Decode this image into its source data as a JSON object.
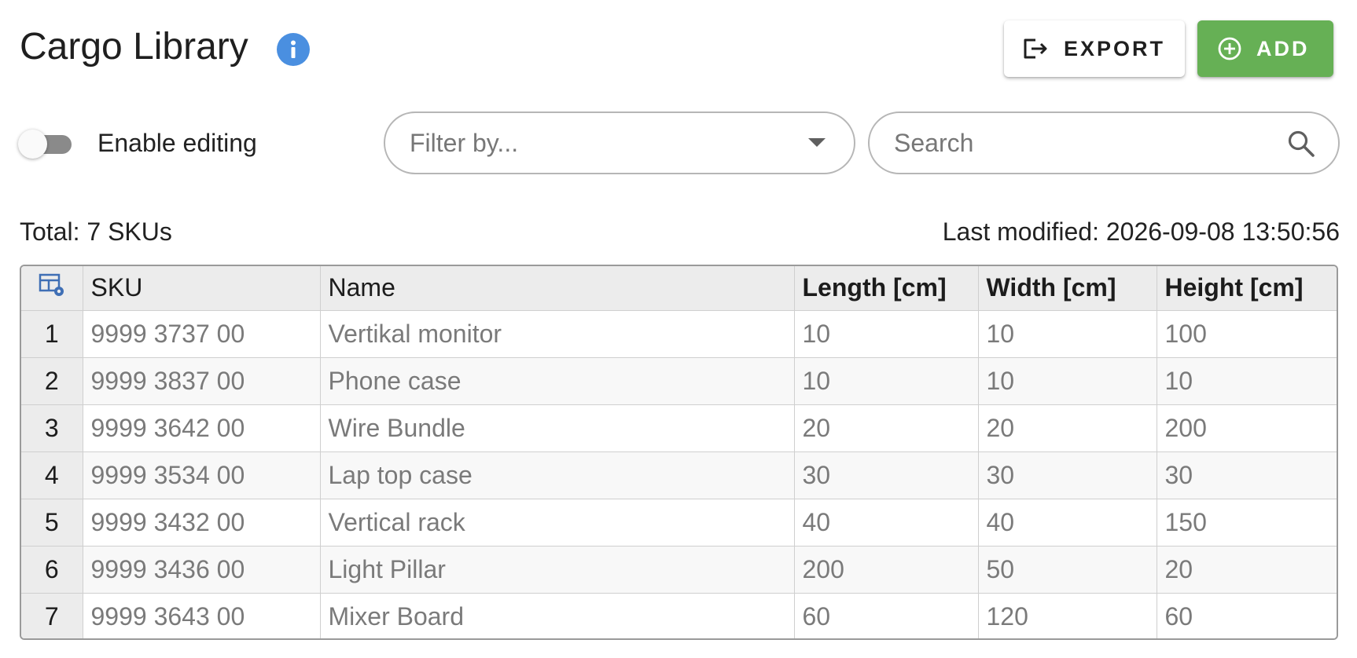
{
  "header": {
    "title": "Cargo Library",
    "export_label": "EXPORT",
    "add_label": "ADD"
  },
  "toolbar": {
    "toggle_label": "Enable editing",
    "toggle_on": false,
    "filter_placeholder": "Filter by...",
    "search_placeholder": "Search"
  },
  "summary": {
    "total": "Total: 7 SKUs",
    "last_modified": "Last modified: 2026-09-08 13:50:56"
  },
  "table": {
    "columns": [
      "SKU",
      "Name",
      "Length [cm]",
      "Width [cm]",
      "Height [cm]"
    ],
    "rows": [
      {
        "num": "1",
        "sku": "9999 3737 00",
        "name": "Vertikal monitor",
        "length": "10",
        "width": "10",
        "height": "100"
      },
      {
        "num": "2",
        "sku": "9999 3837 00",
        "name": "Phone case",
        "length": "10",
        "width": "10",
        "height": "10"
      },
      {
        "num": "3",
        "sku": "9999 3642 00",
        "name": "Wire Bundle",
        "length": "20",
        "width": "20",
        "height": "200"
      },
      {
        "num": "4",
        "sku": "9999 3534 00",
        "name": "Lap top case",
        "length": "30",
        "width": "30",
        "height": "30"
      },
      {
        "num": "5",
        "sku": "9999 3432 00",
        "name": "Vertical rack",
        "length": "40",
        "width": "40",
        "height": "150"
      },
      {
        "num": "6",
        "sku": "9999 3436 00",
        "name": "Light Pillar",
        "length": "200",
        "width": "50",
        "height": "20"
      },
      {
        "num": "7",
        "sku": "9999 3643 00",
        "name": "Mixer Board",
        "length": "60",
        "width": "120",
        "height": "60"
      }
    ]
  },
  "colors": {
    "accent_blue": "#4a8fe0",
    "add_green": "#66b055",
    "toggle_track": "#8a8a8a"
  },
  "icons": {
    "info": "info-icon",
    "export": "export-icon",
    "add": "add-circle-icon",
    "dropdown": "caret-down-icon",
    "search": "search-icon",
    "table_settings": "table-settings-icon"
  }
}
